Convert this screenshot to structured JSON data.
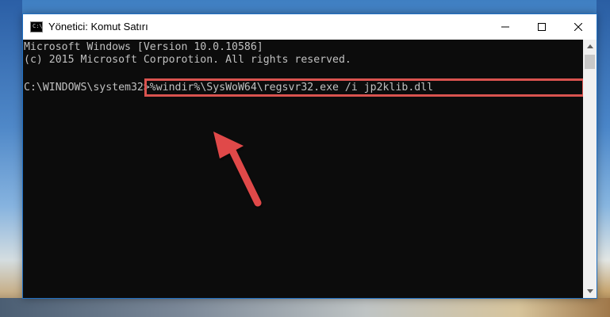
{
  "window": {
    "title": "Yönetici: Komut Satırı",
    "app_icon_text": "C:\\",
    "controls": {
      "minimize": "minimize-icon",
      "maximize": "maximize-icon",
      "close": "close-icon"
    }
  },
  "console": {
    "line1": "Microsoft Windows [Version 10.0.10586]",
    "line2": "(c) 2015 Microsoft Corporotion. All rights reserved.",
    "prompt": "C:\\WINDOWS\\system32>",
    "command": "%windir%\\SysWoW64\\regsvr32.exe /i jp2klib.dll"
  },
  "annotation": {
    "highlight_color": "#d9534f",
    "arrow_color": "#e04848"
  },
  "colors": {
    "console_bg": "#0c0c0c",
    "console_text": "#c0c0c0",
    "window_border": "#1f6fc2"
  }
}
